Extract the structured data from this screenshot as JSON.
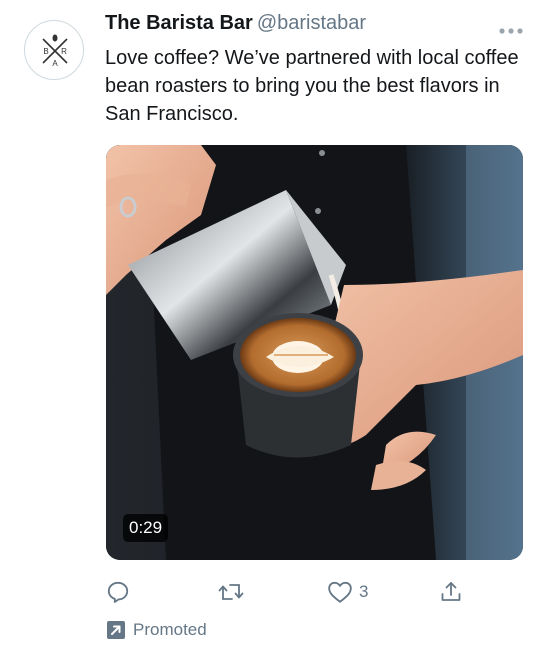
{
  "account": {
    "display_name": "The Barista Bar",
    "handle": "@baristabar",
    "avatar_letters": [
      "B",
      "A",
      "R"
    ]
  },
  "tweet": {
    "text": "Love coffee? We’ve partnered with local coffee bean roasters to bring you the best flavors in San Francisco."
  },
  "media": {
    "type": "video",
    "duration": "0:29",
    "description_icon": "latte-art-pour-image"
  },
  "actions": {
    "reply_icon": "reply-icon",
    "retweet_icon": "retweet-icon",
    "like_icon": "heart-icon",
    "like_count": "3",
    "share_icon": "share-icon"
  },
  "promoted": {
    "label": "Promoted",
    "icon": "promoted-arrow-icon"
  },
  "colors": {
    "text_primary": "#14171a",
    "text_secondary": "#657786",
    "background": "#ffffff"
  }
}
